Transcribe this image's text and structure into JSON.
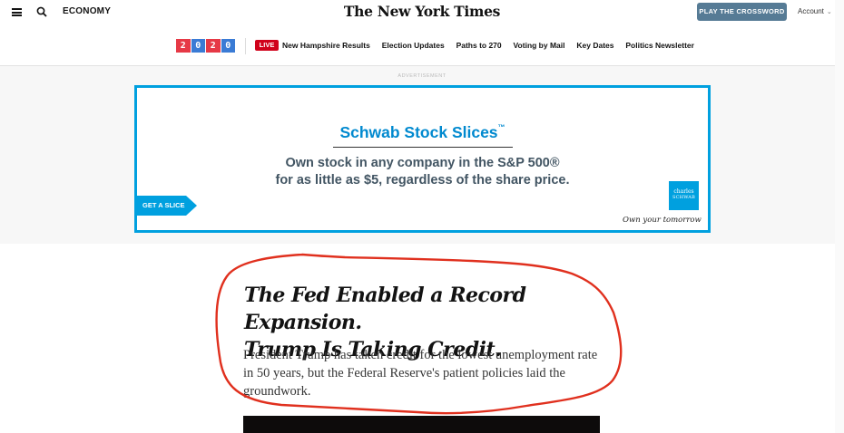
{
  "header": {
    "section": "ECONOMY",
    "masthead": "The New York Times",
    "crossword_button": "PLAY THE CROSSWORD",
    "account_label": "Account",
    "menu_icon": "hamburger-menu-icon",
    "search_icon": "search-icon"
  },
  "election_nav": {
    "year_digits": [
      "2",
      "0",
      "2",
      "0"
    ],
    "year_colors": [
      "#e63946",
      "#3a7bd5",
      "#e63946",
      "#3a7bd5"
    ],
    "live_badge": "LIVE",
    "links": [
      "New Hampshire Results",
      "Election Updates",
      "Paths to 270",
      "Voting by Mail",
      "Key Dates",
      "Politics Newsletter"
    ]
  },
  "ad": {
    "label": "ADVERTISEMENT",
    "title": "Schwab Stock Slices",
    "title_mark": "™",
    "body_line1": "Own stock in any company in the S&P 500®",
    "body_line2": "for as little as $5, regardless of the share price.",
    "cta": "GET A SLICE",
    "logo_line1": "charles",
    "logo_line2": "SCHWAB",
    "tagline": "Own your tomorrow",
    "accent_color": "#00a0df"
  },
  "article": {
    "headline_line1": "The Fed Enabled a Record Expansion.",
    "headline_line2": "Trump Is Taking Credit.",
    "summary": "President Trump has taken credit for the lowest unemployment rate in 50 years, but the Federal Reserve's patient policies laid the groundwork."
  },
  "annotation": {
    "color": "#e0301e"
  }
}
